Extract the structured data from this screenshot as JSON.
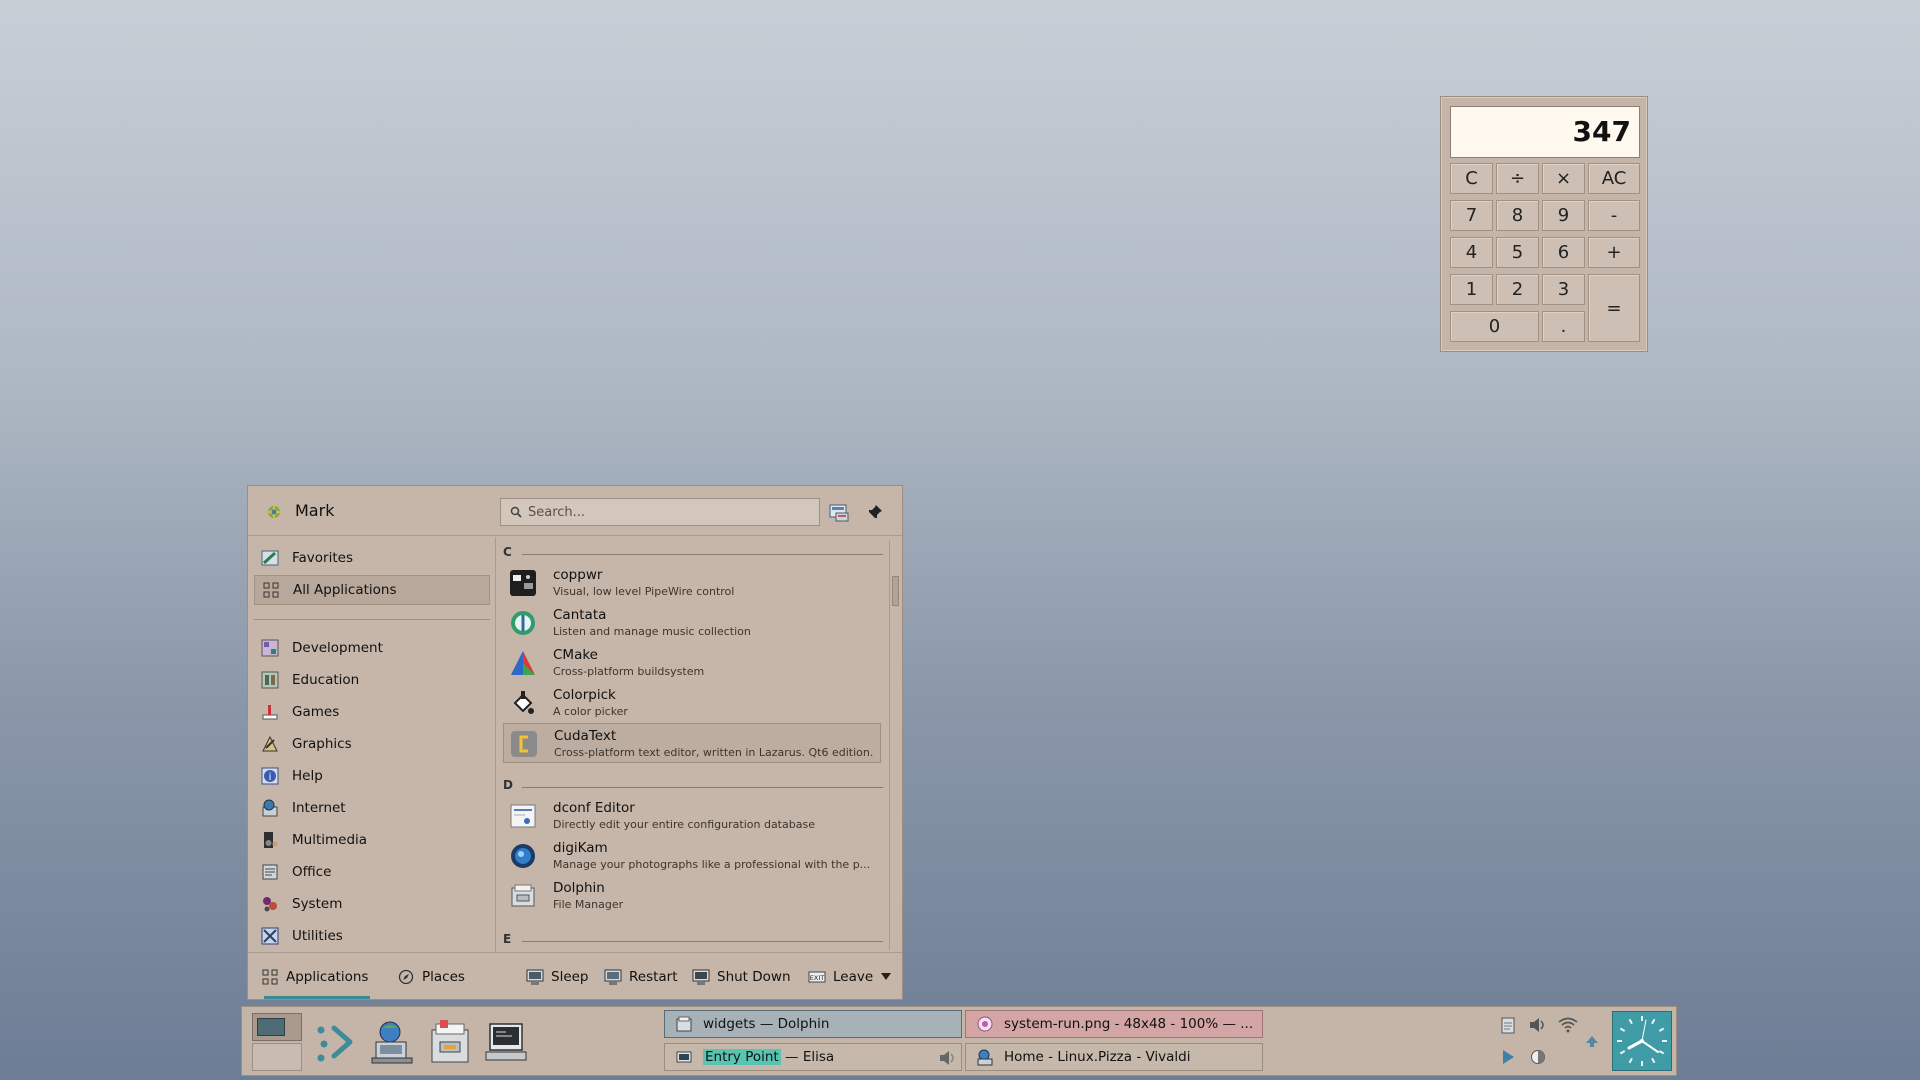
{
  "calculator": {
    "display": "347",
    "keys": [
      "C",
      "÷",
      "×",
      "AC",
      "7",
      "8",
      "9",
      "-",
      "4",
      "5",
      "6",
      "+",
      "1",
      "2",
      "3",
      "=",
      "0",
      "."
    ]
  },
  "menu": {
    "user": "Mark",
    "search_placeholder": "Search...",
    "categories": [
      {
        "label": "Favorites",
        "icon": "favorites-icon"
      },
      {
        "label": "All Applications",
        "icon": "grid-icon",
        "active": true
      },
      {
        "label": "Development",
        "icon": "development-icon"
      },
      {
        "label": "Education",
        "icon": "education-icon"
      },
      {
        "label": "Games",
        "icon": "games-icon"
      },
      {
        "label": "Graphics",
        "icon": "graphics-icon"
      },
      {
        "label": "Help",
        "icon": "help-icon"
      },
      {
        "label": "Internet",
        "icon": "internet-icon"
      },
      {
        "label": "Multimedia",
        "icon": "multimedia-icon"
      },
      {
        "label": "Office",
        "icon": "office-icon"
      },
      {
        "label": "System",
        "icon": "system-icon"
      },
      {
        "label": "Utilities",
        "icon": "utilities-icon"
      }
    ],
    "sections": [
      "C",
      "D",
      "E"
    ],
    "apps": [
      {
        "name": "coppwr",
        "desc": "Visual, low level PipeWire control",
        "icon": "coppwr-icon"
      },
      {
        "name": "Cantata",
        "desc": "Listen and manage music collection",
        "icon": "cantata-icon"
      },
      {
        "name": "CMake",
        "desc": "Cross-platform buildsystem",
        "icon": "cmake-icon"
      },
      {
        "name": "Colorpick",
        "desc": "A color picker",
        "icon": "colorpick-icon"
      },
      {
        "name": "CudaText",
        "desc": "Cross-platform text editor, written in Lazarus. Qt6 edition.",
        "icon": "cudatext-icon",
        "highlight": true
      },
      {
        "name": "dconf Editor",
        "desc": "Directly edit your entire configuration database",
        "icon": "dconf-icon"
      },
      {
        "name": "digiKam",
        "desc": "Manage your photographs like a professional with the p...",
        "icon": "digikam-icon"
      },
      {
        "name": "Dolphin",
        "desc": "File Manager",
        "icon": "dolphin-icon"
      }
    ],
    "footer": {
      "tab_applications": "Applications",
      "tab_places": "Places",
      "sleep": "Sleep",
      "restart": "Restart",
      "shutdown": "Shut Down",
      "leave": "Leave"
    }
  },
  "taskbar": {
    "tasks": [
      {
        "title": "widgets — Dolphin",
        "icon": "dolphin-icon",
        "state": "active"
      },
      {
        "title": "system-run.png - 48x48 - 100% — ...",
        "icon": "image-viewer-icon",
        "state": "attention"
      },
      {
        "highlight": "Entry Point",
        "title": " — Elisa",
        "icon": "elisa-icon",
        "state": "normal"
      },
      {
        "title": "Home - Linux.Pizza - Vivaldi",
        "icon": "vivaldi-icon",
        "state": "normal"
      }
    ]
  },
  "colors": {
    "accent": "#3d8a95",
    "panel": "#c5b5a8",
    "clock_bg": "#3f9ca6"
  }
}
